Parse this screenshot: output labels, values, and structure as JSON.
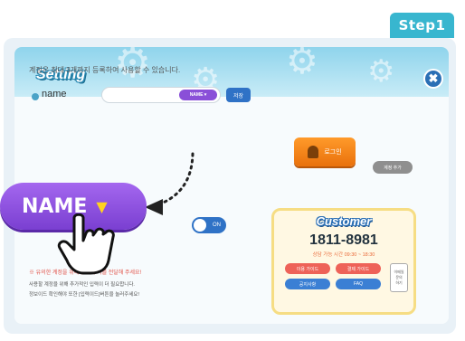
{
  "step": {
    "label": "Step1"
  },
  "dialog": {
    "title": "Setting",
    "close_label": "✖",
    "info": "계정은 최대 3개까지 등록하여 사용할 수 있습니다.",
    "name_label": "name",
    "name_pill": "NAME ▾",
    "save_label": "저장",
    "login_label": "로그인",
    "signup_label": "계정 추가",
    "toggle_label": "ON",
    "notice_red": "※ 유의한 계정을 위해 반드시 이를 전달해 주세요!",
    "notice_1": "사용할 계정을 위해 추가적인 입력이 더 필요합니다.",
    "notice_2": "정보이드 확인해야 또한 [입력이드]버튼을 눌러주세요!"
  },
  "customer": {
    "title": "Customer",
    "phone": "1811-8981",
    "hours": "상담 가능 시간 09:30 ~ 18:30",
    "buttons": [
      "이용 가이드",
      "결제 가이드",
      "공지사항",
      "FAQ"
    ],
    "memo": [
      "이메일",
      "문의",
      "하기"
    ]
  },
  "callout": {
    "name_label": "NAME",
    "triangle": "▼"
  },
  "colors": {
    "accent": "#38b6cf",
    "purple": "#8a4fd8",
    "login_orange": "#f08518",
    "customer_border": "#f6dd84"
  }
}
